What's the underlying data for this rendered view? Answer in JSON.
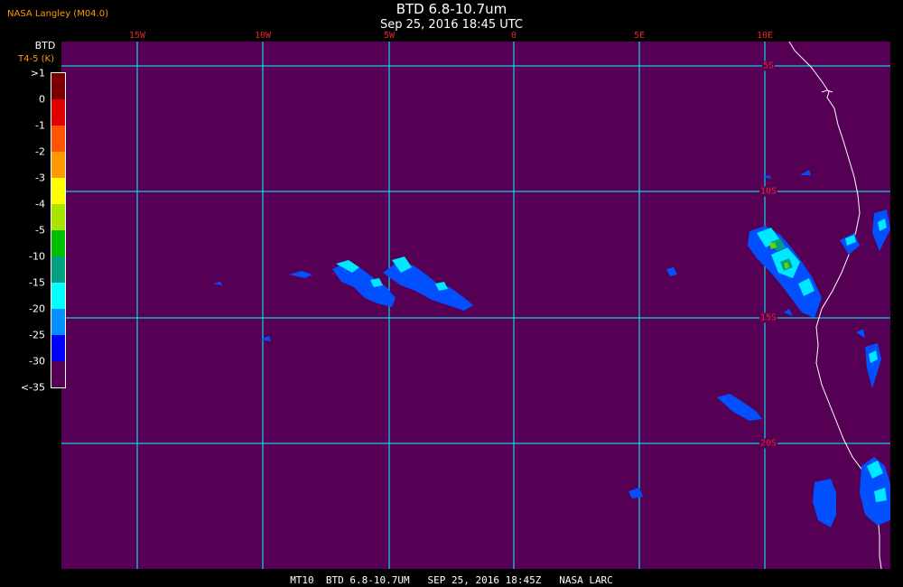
{
  "producer": "NASA Langley (M04.0)",
  "title": "BTD 6.8-10.7um",
  "timestamp": "Sep 25, 2016 18:45 UTC",
  "footer": "MT10  BTD 6.8-10.7UM   SEP 25, 2016 18:45Z   NASA LARC",
  "colorbar": {
    "title": "BTD",
    "units": "T4-5 (K)",
    "ticks": [
      ">1",
      "0",
      "-1",
      "-2",
      "-3",
      "-4",
      "-5",
      "-10",
      "-15",
      "-20",
      "-25",
      "-30",
      "<-35"
    ],
    "colors": [
      "#7a0000",
      "#e00000",
      "#ff5500",
      "#ff9900",
      "#ffff00",
      "#a8e600",
      "#00c000",
      "#00a080",
      "#00ffff",
      "#0090ff",
      "#0000ff",
      "#550055"
    ]
  },
  "grid": {
    "longitudes": [
      "15W",
      "10W",
      "5W",
      "0",
      "5E",
      "10E"
    ],
    "latitudes": [
      "5S",
      "10S",
      "15S",
      "20S"
    ]
  },
  "colors": {
    "background": "#550055",
    "grid": "#00ffff",
    "grid_label": "#e8252a",
    "coast": "#ffffff"
  }
}
